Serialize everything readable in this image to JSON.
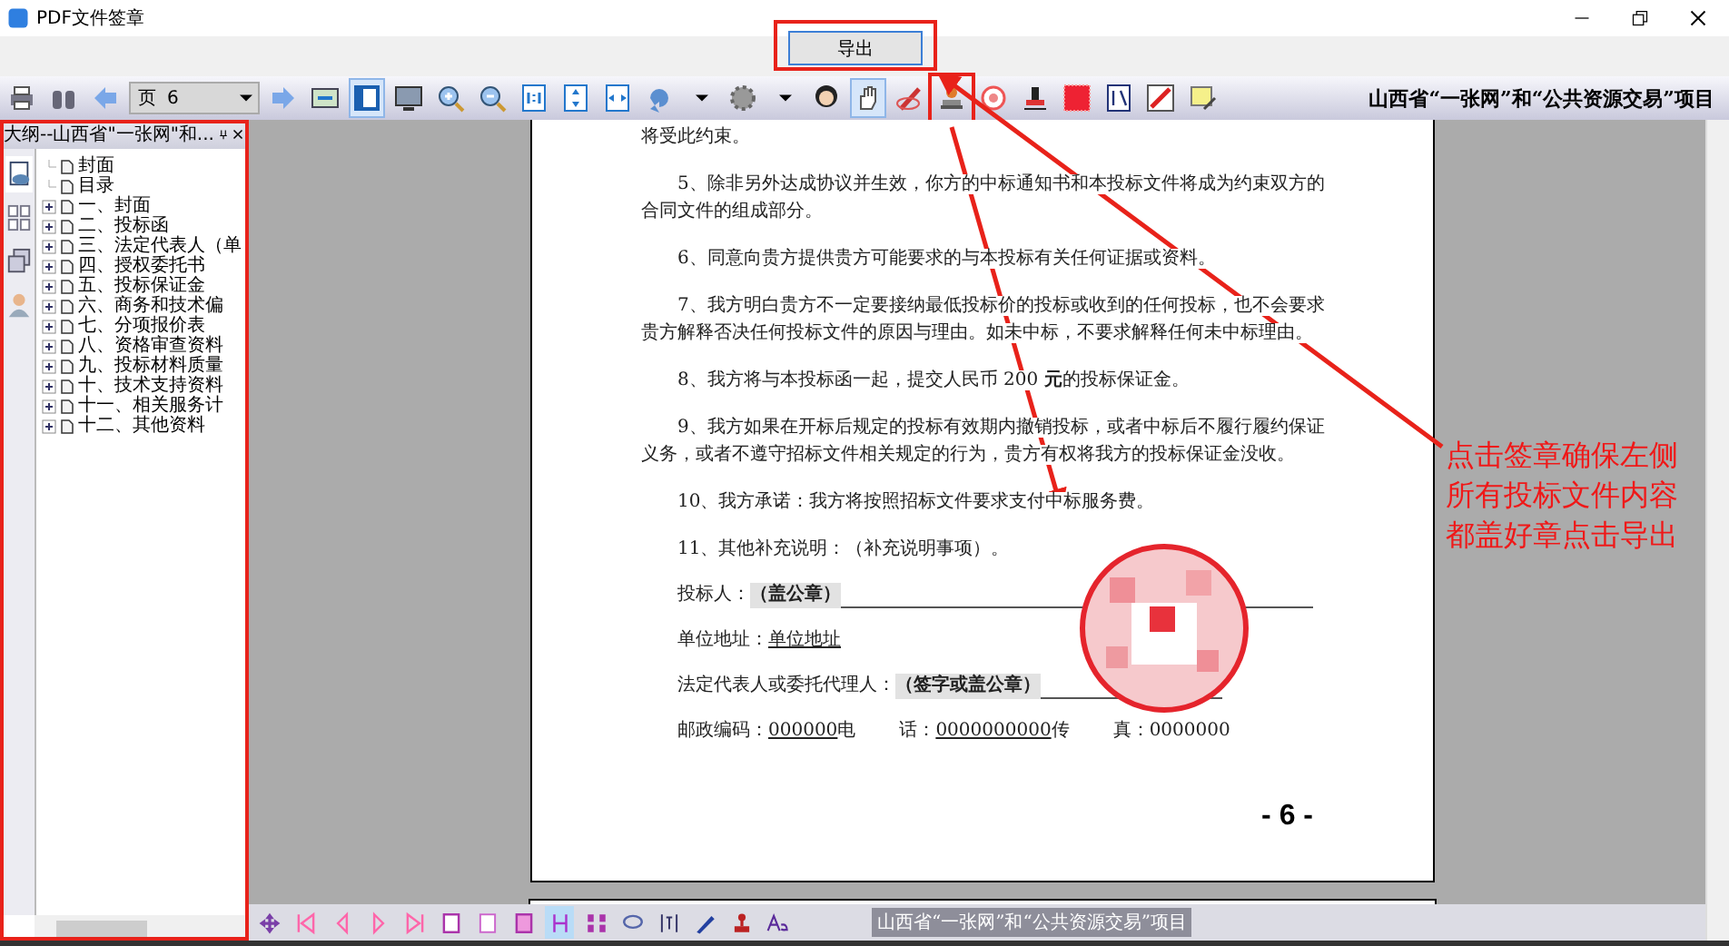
{
  "window": {
    "title": "PDF文件签章"
  },
  "export_button": {
    "label": "导出",
    "framed": true
  },
  "toolbar": {
    "page_label": "页",
    "page_value": "6",
    "document_title": "山西省“一张网”和“公共资源交易”项目",
    "tools": [
      {
        "selected": false,
        "framed": false
      },
      {
        "selected": false,
        "framed": false
      },
      {
        "selected": false,
        "framed": false
      },
      {
        "selected": false,
        "framed": false
      },
      {
        "selected": false,
        "framed": false
      },
      {
        "selected": true,
        "framed": false
      },
      {
        "selected": false,
        "framed": false
      },
      {
        "selected": false,
        "framed": false
      },
      {
        "selected": false,
        "framed": false
      },
      {
        "selected": false,
        "framed": false
      },
      {
        "selected": false,
        "framed": false
      },
      {
        "selected": false,
        "framed": false
      },
      {
        "selected": false,
        "framed": false
      },
      {
        "selected": false,
        "framed": false
      },
      {
        "selected": false,
        "framed": false
      },
      {
        "selected": false,
        "framed": false
      },
      {
        "selected": false,
        "framed": false
      },
      {
        "selected": true,
        "framed": false
      },
      {
        "selected": false,
        "framed": false
      },
      {
        "selected": false,
        "framed": true
      },
      {
        "selected": false,
        "framed": false
      },
      {
        "selected": false,
        "framed": false
      },
      {
        "selected": false,
        "framed": false
      },
      {
        "selected": false,
        "framed": false
      },
      {
        "selected": false,
        "framed": false
      },
      {
        "selected": false,
        "framed": false
      }
    ]
  },
  "outline": {
    "title": "大纲--山西省\"一张网\"和...",
    "framed": true,
    "side_tabs": [
      {
        "selected": true
      },
      {
        "selected": false
      },
      {
        "selected": false
      },
      {
        "selected": false
      }
    ],
    "items": [
      {
        "label": "封面",
        "kind": "leaf"
      },
      {
        "label": "目录",
        "kind": "leaf"
      },
      {
        "label": "一、封面",
        "kind": "collapsed"
      },
      {
        "label": "二、投标函",
        "kind": "collapsed"
      },
      {
        "label": "三、法定代表人（单",
        "kind": "collapsed"
      },
      {
        "label": "四、授权委托书",
        "kind": "collapsed"
      },
      {
        "label": "五、投标保证金",
        "kind": "collapsed"
      },
      {
        "label": "六、商务和技术偏",
        "kind": "collapsed"
      },
      {
        "label": "七、分项报价表",
        "kind": "collapsed"
      },
      {
        "label": "八、资格审查资料",
        "kind": "collapsed"
      },
      {
        "label": "九、投标材料质量",
        "kind": "collapsed"
      },
      {
        "label": "十、技术支持资料",
        "kind": "collapsed"
      },
      {
        "label": "十一、相关服务计",
        "kind": "collapsed"
      },
      {
        "label": "十二、其他资料",
        "kind": "collapsed"
      }
    ]
  },
  "page": {
    "paragraphs": [
      {
        "text": "将受此约束。",
        "kind": "continuation"
      },
      {
        "text": "5、除非另外达成协议并生效，你方的中标通知书和本投标文件将成为约束双方的合同文件的组成部分。",
        "kind": "numbered"
      },
      {
        "text": "6、同意向贵方提供贵方可能要求的与本投标有关任何证据或资料。",
        "kind": "numbered"
      },
      {
        "text": "7、我方明白贵方不一定要接纳最低投标价的投标或收到的任何投标，也不会要求贵方解释否决任何投标文件的原因与理由。如未中标，不要求解释任何未中标理由。",
        "kind": "numbered"
      },
      {
        "text": "8、我方将与本投标函一起，提交人民币 200 **元**的投标保证金。",
        "kind": "numbered"
      },
      {
        "text": "9、我方如果在开标后规定的投标有效期内撤销投标，或者中标后不履行履约保证义务，或者不遵守招标文件相关规定的行为，贵方有权将我方的投标保证金没收。",
        "kind": "numbered"
      },
      {
        "text": "10、我方承诺：我方将按照招标文件要求支付中标服务费。",
        "kind": "numbered"
      },
      {
        "text": "11、其他补充说明：（补充说明事项）。",
        "kind": "numbered"
      }
    ],
    "bidder_label": "投标人：",
    "bidder_value": "（盖公章）",
    "address_label": "单位地址：",
    "address_value": "单位地址",
    "representative_label": "法定代表人或委托代理人：",
    "representative_value": "（签字或盖公章）",
    "postcode_label": "邮政编码：",
    "postcode_value": "000000",
    "phone_label_1": "电",
    "phone_label_2": "话：",
    "phone_value": "0000000000",
    "fax_label_1": "传",
    "fax_label_2": "真：",
    "fax_value": "0000000",
    "page_number": "- 6 -"
  },
  "bottom_toolbar": {
    "tools": [
      {
        "selected": false
      },
      {
        "selected": false
      },
      {
        "selected": false
      },
      {
        "selected": false
      },
      {
        "selected": false
      },
      {
        "selected": false
      },
      {
        "selected": false
      },
      {
        "selected": false
      },
      {
        "selected": true
      },
      {
        "selected": false
      },
      {
        "selected": false
      },
      {
        "selected": false
      },
      {
        "selected": false
      },
      {
        "selected": false
      },
      {
        "selected": false
      }
    ],
    "footer_title": "山西省“一张网”和“公共资源交易”项目"
  },
  "annotation": {
    "lines": [
      "点击签章确保左侧",
      "所有投标文件内容",
      "都盖好章点击导出"
    ]
  }
}
